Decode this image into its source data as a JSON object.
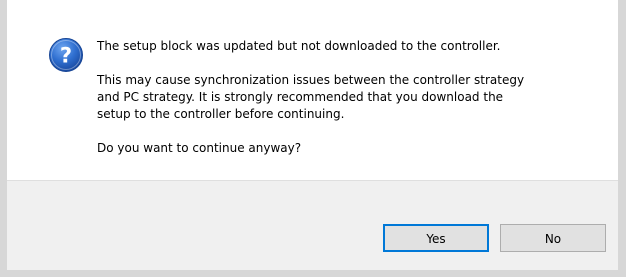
{
  "dialog": {
    "icon": "question-icon",
    "message": {
      "line1": "The setup block was updated but not downloaded to the controller.",
      "line2": "This may cause synchronization issues between the controller strategy\nand PC strategy. It is strongly recommended that you download the\nsetup to the controller before continuing.",
      "line3": "Do you want to continue anyway?"
    },
    "buttons": {
      "yes_label": "Yes",
      "no_label": "No"
    },
    "colors": {
      "icon_blue": "#1f5fbf",
      "footer_bg": "#f0f0f0",
      "focus_border": "#0078d7"
    }
  }
}
